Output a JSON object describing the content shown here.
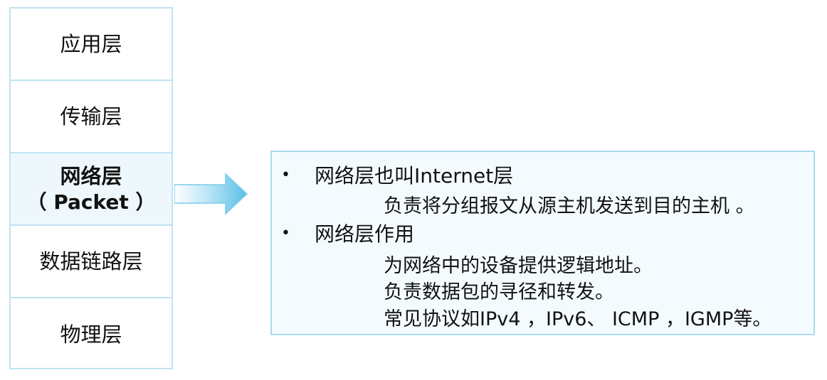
{
  "layers": [
    {
      "label": "应用层",
      "sub": ""
    },
    {
      "label": "传输层",
      "sub": ""
    },
    {
      "label": "网络层",
      "sub": "（ Packet ）"
    },
    {
      "label": "数据链路层",
      "sub": ""
    },
    {
      "label": "物理层",
      "sub": ""
    }
  ],
  "highlight_index": 2,
  "panel": {
    "bullets": [
      {
        "marker": "•",
        "title": "网络层也叫Internet层",
        "details": [
          "负责将分组报文从源主机发送到目的主机 。"
        ]
      },
      {
        "marker": "•",
        "title": "网络层作用",
        "details": [
          "为网络中的设备提供逻辑地址。",
          "负责数据包的寻径和转发。",
          "常见协议如IPv4 ，IPv6、 ICMP ，IGMP等。"
        ]
      }
    ]
  },
  "colors": {
    "border": "#bfe3f2",
    "panel_background": "#f4fbfe",
    "arrow_light": "#e6f6fc",
    "arrow_dark": "#5bbfe6"
  }
}
